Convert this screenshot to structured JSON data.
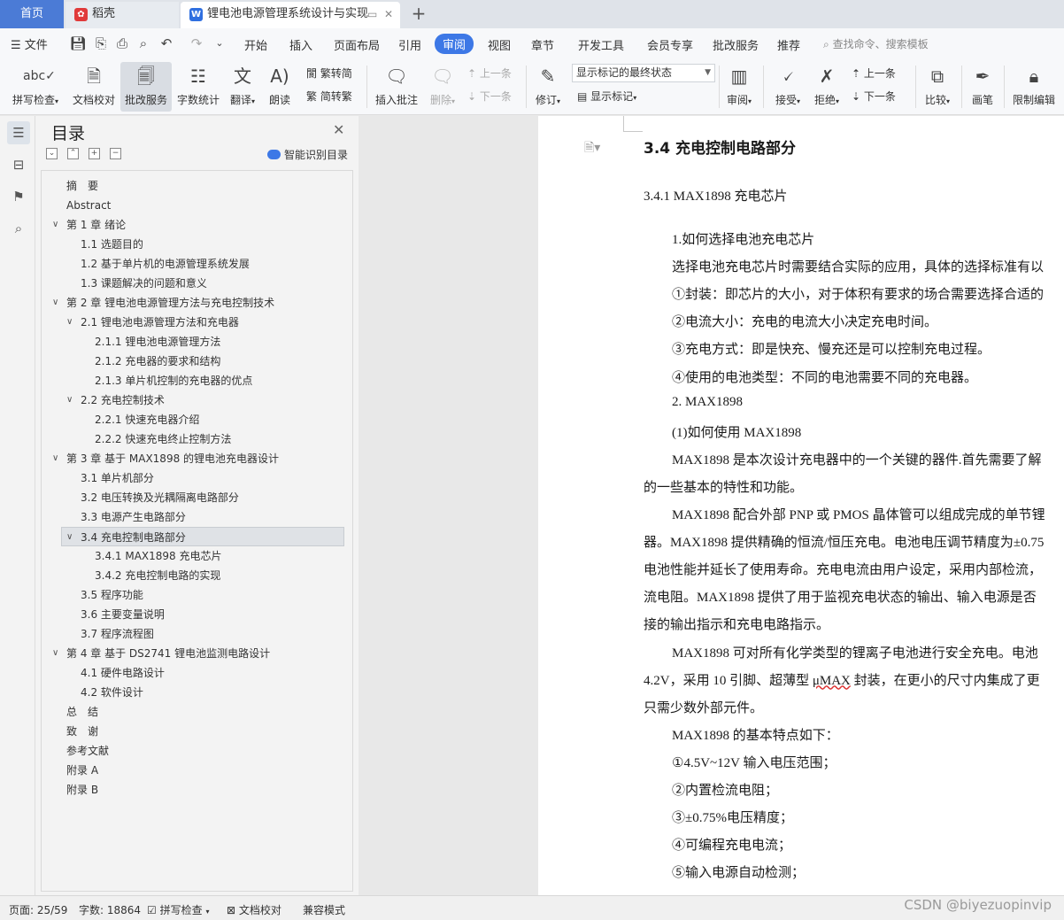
{
  "tabs": {
    "home": "首页",
    "daoke": "稻壳",
    "document": "锂电池电源管理系统设计与实现"
  },
  "menu": {
    "file": "文件",
    "items": [
      "开始",
      "插入",
      "页面布局",
      "引用",
      "审阅",
      "视图",
      "章节",
      "开发工具",
      "会员专享",
      "批改服务",
      "推荐"
    ],
    "search_placeholder": "查找命令、搜索模板"
  },
  "ribbon": {
    "spell_check": "拼写检查",
    "doc_proof": "文档校对",
    "revise_service": "批改服务",
    "word_count": "字数统计",
    "translate": "翻译",
    "read_aloud": "朗读",
    "trad_simp": "繁转简",
    "simp_trad": "简转繁",
    "insert_comment": "插入批注",
    "delete": "删除",
    "prev_comment": "上一条",
    "next_comment": "下一条",
    "track": "修订",
    "markup_select": "显示标记的最终状态",
    "show_markup": "显示标记",
    "review": "审阅",
    "accept": "接受",
    "reject": "拒绝",
    "prev_change": "上一条",
    "next_change": "下一条",
    "compare": "比较",
    "pen": "画笔",
    "restrict_edit": "限制编辑"
  },
  "toc": {
    "title": "目录",
    "ai_label": "智能识别目录",
    "items": [
      {
        "text": "摘　要",
        "level": 0,
        "caret": false
      },
      {
        "text": "Abstract",
        "level": 0,
        "caret": false
      },
      {
        "text": "第 1 章  绪论",
        "level": 0,
        "caret": true
      },
      {
        "text": "1.1  选题目的",
        "level": 1,
        "caret": false
      },
      {
        "text": "1.2  基于单片机的电源管理系统发展",
        "level": 1,
        "caret": false
      },
      {
        "text": "1.3  课题解决的问题和意义",
        "level": 1,
        "caret": false
      },
      {
        "text": "第 2 章  锂电池电源管理方法与充电控制技术",
        "level": 0,
        "caret": true
      },
      {
        "text": "2.1  锂电池电源管理方法和充电器",
        "level": 1,
        "caret": true
      },
      {
        "text": "2.1.1 锂电池电源管理方法",
        "level": 2,
        "caret": false
      },
      {
        "text": "2.1.2 充电器的要求和结构",
        "level": 2,
        "caret": false
      },
      {
        "text": "2.1.3 单片机控制的充电器的优点",
        "level": 2,
        "caret": false
      },
      {
        "text": "2.2  充电控制技术",
        "level": 1,
        "caret": true
      },
      {
        "text": "2.2.1  快速充电器介绍",
        "level": 2,
        "caret": false
      },
      {
        "text": "2.2.2  快速充电终止控制方法",
        "level": 2,
        "caret": false
      },
      {
        "text": " 第 3 章  基于 MAX1898 的锂电池充电器设计",
        "level": 0,
        "caret": true
      },
      {
        "text": "3.1  单片机部分",
        "level": 1,
        "caret": false
      },
      {
        "text": "3.2  电压转换及光耦隔离电路部分",
        "level": 1,
        "caret": false
      },
      {
        "text": "3.3  电源产生电路部分",
        "level": 1,
        "caret": false
      },
      {
        "text": "3.4  充电控制电路部分",
        "level": 1,
        "caret": true,
        "selected": true
      },
      {
        "text": "3.4.1 MAX1898 充电芯片",
        "level": 2,
        "caret": false
      },
      {
        "text": "3.4.2 充电控制电路的实现",
        "level": 2,
        "caret": false
      },
      {
        "text": "3.5  程序功能",
        "level": 1,
        "caret": false
      },
      {
        "text": "3.6  主要变量说明",
        "level": 1,
        "caret": false
      },
      {
        "text": "3.7  程序流程图",
        "level": 1,
        "caret": false
      },
      {
        "text": "第 4 章  基于 DS2741 锂电池监测电路设计",
        "level": 0,
        "caret": true
      },
      {
        "text": "4.1  硬件电路设计",
        "level": 1,
        "caret": false
      },
      {
        "text": "4.2  软件设计",
        "level": 1,
        "caret": false
      },
      {
        "text": "总　结",
        "level": 0,
        "caret": false
      },
      {
        "text": "致　谢",
        "level": 0,
        "caret": false
      },
      {
        "text": "参考文献",
        "level": 0,
        "caret": false
      },
      {
        "text": "附录 A",
        "level": 0,
        "caret": false
      },
      {
        "text": "附录 B",
        "level": 0,
        "caret": false
      }
    ]
  },
  "document": {
    "heading": "3.4  充电控制电路部分",
    "subheading": "3.4.1 MAX1898 充电芯片",
    "lines": [
      "1.如何选择电池充电芯片",
      "选择电池充电芯片时需要结合实际的应用，具体的选择标准有以",
      "①封装：即芯片的大小，对于体积有要求的场合需要选择合适的",
      "②电流大小：充电的电流大小决定充电时间。",
      "③充电方式：即是快充、慢充还是可以控制充电过程。",
      "④使用的电池类型：不同的电池需要不同的充电器。",
      "2.  MAX1898",
      "(1)如何使用 MAX1898",
      "MAX1898 是本次设计充电器中的一个关键的器件.首先需要了解",
      "的一些基本的特性和功能。",
      "MAX1898 配合外部 PNP 或 PMOS 晶体管可以组成完成的单节锂",
      "器。MAX1898 提供精确的恒流/恒压充电。电池电压调节精度为±0.75",
      "电池性能并延长了使用寿命。充电电流由用户设定，采用内部检流，",
      "流电阻。MAX1898 提供了用于监视充电状态的输出、输入电源是否",
      "接的输出指示和充电电路指示。",
      "MAX1898 可对所有化学类型的锂离子电池进行安全充电。电池",
      "4.2V，采用 10 引脚、超薄型  μMAX 封装，在更小的尺寸内集成了更",
      "只需少数外部元件。",
      "MAX1898 的基本特点如下：",
      "①4.5V~12V 输入电压范围；",
      "②内置检流电阻；",
      "③±0.75%电压精度；",
      "④可编程充电电流；",
      "⑤输入电源自动检测；"
    ]
  },
  "status": {
    "page": "页面: 25/59",
    "words": "字数: 18864",
    "spell": "拼写检查",
    "proof": "文档校对",
    "compat": "兼容模式"
  },
  "watermark": "CSDN @biyezuopinvip",
  "colors": {
    "accent": "#3d78e6",
    "home_tab": "#4b7bd6"
  }
}
